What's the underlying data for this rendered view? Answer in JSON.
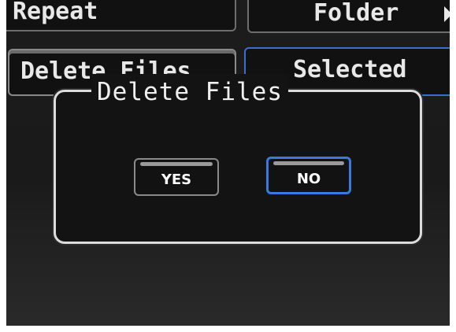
{
  "menu": {
    "repeat_label": "Repeat",
    "folder_label": "Folder",
    "delete_files_label": "Delete Files",
    "selected_label": "Selected"
  },
  "dialog": {
    "title": "Delete Files",
    "yes_label": "YES",
    "no_label": "NO",
    "focused_button": "NO"
  },
  "colors": {
    "focus_border": "#3b78e0",
    "dialog_border": "#dcdcdc",
    "background": "#1a1a1a"
  },
  "icons": {
    "folder_arrow": "triangle-right-icon"
  }
}
